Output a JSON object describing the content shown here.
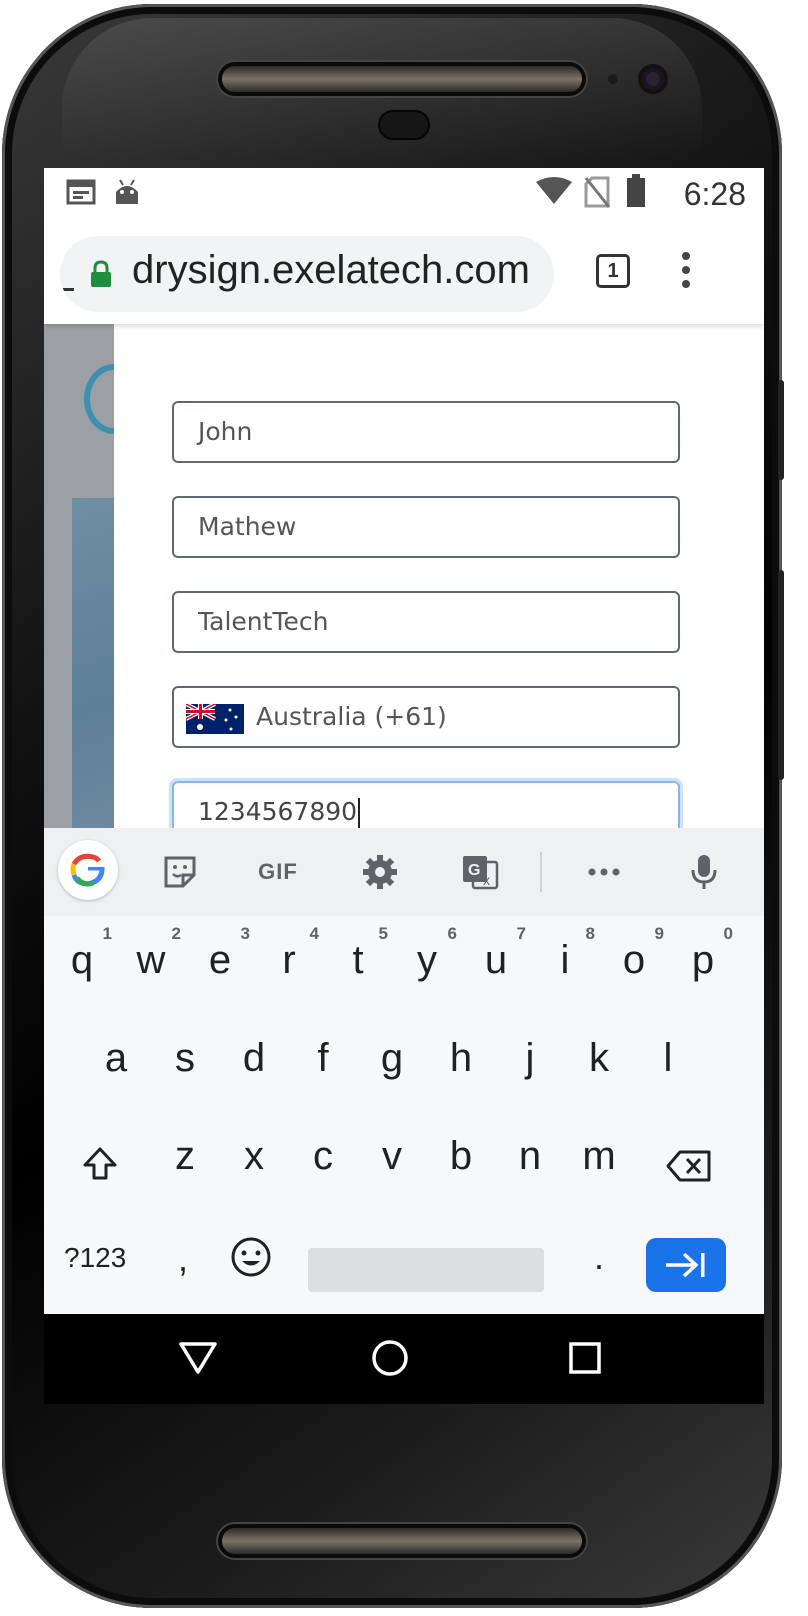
{
  "status_bar": {
    "time": "6:28",
    "left_icons": [
      "calendar-icon",
      "android-icon"
    ],
    "right_icons": [
      "wifi-icon",
      "no-sim-icon",
      "battery-icon"
    ]
  },
  "browser": {
    "url": "drysign.exelatech.com",
    "tab_count": "1",
    "lock_color": "#1e8e3e"
  },
  "form": {
    "first_name": "John",
    "last_name": "Mathew",
    "company": "TalentTech",
    "country": "Australia (+61)",
    "phone": "1234567890"
  },
  "keyboard": {
    "toolbar": {
      "gif_label": "GIF",
      "icons": [
        "google-icon",
        "sticker-icon",
        "settings-icon",
        "translate-icon",
        "more-icon",
        "mic-icon"
      ]
    },
    "row1": [
      {
        "key": "q",
        "hint": "1"
      },
      {
        "key": "w",
        "hint": "2"
      },
      {
        "key": "e",
        "hint": "3"
      },
      {
        "key": "r",
        "hint": "4"
      },
      {
        "key": "t",
        "hint": "5"
      },
      {
        "key": "y",
        "hint": "6"
      },
      {
        "key": "u",
        "hint": "7"
      },
      {
        "key": "i",
        "hint": "8"
      },
      {
        "key": "o",
        "hint": "9"
      },
      {
        "key": "p",
        "hint": "0"
      }
    ],
    "row2": [
      "a",
      "s",
      "d",
      "f",
      "g",
      "h",
      "j",
      "k",
      "l"
    ],
    "row3": [
      "z",
      "x",
      "c",
      "v",
      "b",
      "n",
      "m"
    ],
    "symbols_label": "?123",
    "comma": ",",
    "period": ".",
    "enter_color": "#1a73e8"
  },
  "nav_bar": {
    "icons": [
      "back-icon",
      "home-icon",
      "recents-icon"
    ]
  }
}
